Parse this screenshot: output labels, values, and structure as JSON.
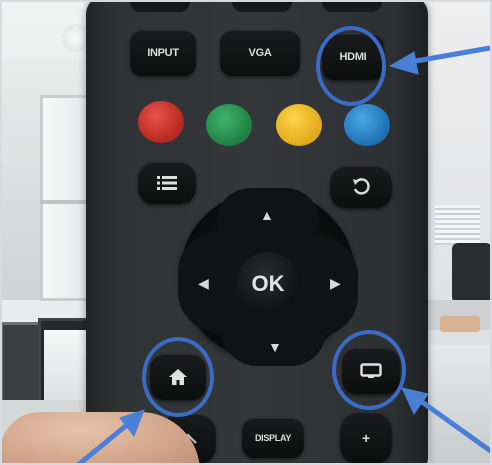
{
  "remote": {
    "buttons": {
      "input_label": "INPUT",
      "vga_label": "VGA",
      "hdmi_label": "HDMI",
      "ok_label": "OK",
      "display_label": "DISPLAY",
      "vol_up_label": "+"
    },
    "color_buttons": [
      "red",
      "green",
      "yellow",
      "blue"
    ],
    "icons": {
      "menu": "menu-list-icon",
      "back": "back-return-icon",
      "up": "arrow-up-icon",
      "down": "arrow-down-icon",
      "left": "arrow-left-icon",
      "right": "arrow-right-icon",
      "home": "home-icon",
      "source": "tv-source-icon",
      "channel_up": "chevron-up-icon"
    }
  },
  "annotations": {
    "highlight_color": "#3a6cc6",
    "highlighted": [
      "HDMI",
      "home",
      "source"
    ]
  }
}
